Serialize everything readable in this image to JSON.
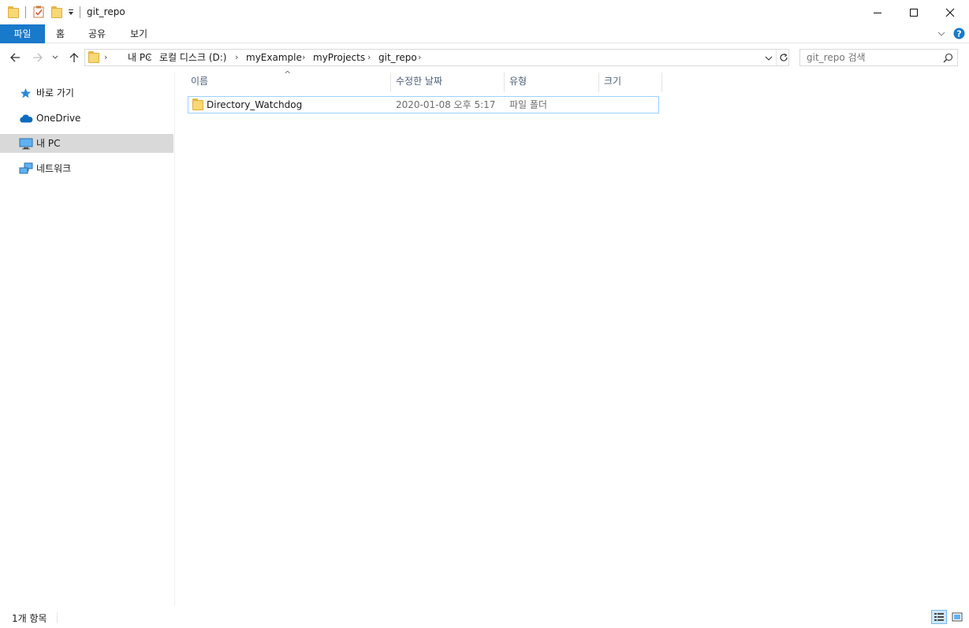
{
  "window": {
    "title": "git_repo",
    "buttons": {
      "minimize": "minimize-icon",
      "maximize": "maximize-icon",
      "close": "close-icon"
    }
  },
  "quick_access_toolbar": {
    "icons": [
      "folder-icon",
      "properties-icon",
      "new-folder-icon",
      "customize-dropdown-icon"
    ]
  },
  "ribbon": {
    "tabs": [
      {
        "label": "파일",
        "active": true
      },
      {
        "label": "홈"
      },
      {
        "label": "공유"
      },
      {
        "label": "보기"
      }
    ],
    "accent": "#1979ca"
  },
  "address": {
    "crumbs": [
      "내 PC",
      "로컬 디스크 (D:)",
      "myExample",
      "myProjects",
      "git_repo"
    ]
  },
  "search": {
    "placeholder": "git_repo 검색"
  },
  "nav_pane": {
    "items": [
      {
        "label": "바로 가기",
        "icon": "star-icon"
      },
      {
        "label": "OneDrive",
        "icon": "cloud-icon"
      },
      {
        "label": "내 PC",
        "icon": "computer-icon",
        "selected": true
      },
      {
        "label": "네트워크",
        "icon": "network-icon"
      }
    ]
  },
  "file_list": {
    "columns": [
      "이름",
      "수정한 날짜",
      "유형",
      "크기"
    ],
    "sort_indicator": "^",
    "rows": [
      {
        "name": "Directory_Watchdog",
        "modified": "2020-01-08 오후 5:17",
        "type": "파일 폴더",
        "size": ""
      }
    ]
  },
  "status_bar": {
    "item_count": "1개 항목"
  }
}
